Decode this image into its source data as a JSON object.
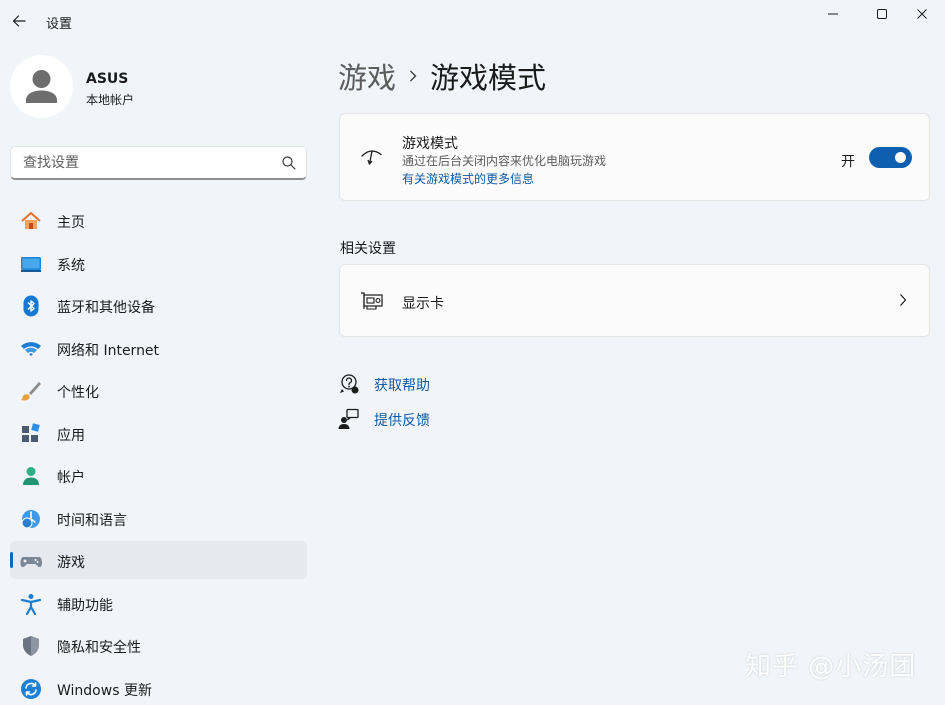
{
  "window": {
    "title": "设置",
    "back_icon": "arrow-left-icon",
    "minimize_icon": "minimize-icon",
    "maximize_icon": "maximize-icon",
    "close_icon": "close-icon"
  },
  "profile": {
    "name": "ASUS",
    "account_type": "本地帐户"
  },
  "search": {
    "placeholder": "查找设置",
    "value": ""
  },
  "sidebar": {
    "selected_index": 8,
    "items": [
      {
        "label": "主页",
        "icon": "home-icon"
      },
      {
        "label": "系统",
        "icon": "system-icon"
      },
      {
        "label": "蓝牙和其他设备",
        "icon": "bluetooth-icon"
      },
      {
        "label": "网络和 Internet",
        "icon": "wifi-icon"
      },
      {
        "label": "个性化",
        "icon": "brush-icon"
      },
      {
        "label": "应用",
        "icon": "apps-icon"
      },
      {
        "label": "帐户",
        "icon": "account-icon"
      },
      {
        "label": "时间和语言",
        "icon": "time-language-icon"
      },
      {
        "label": "游戏",
        "icon": "gamepad-icon"
      },
      {
        "label": "辅助功能",
        "icon": "accessibility-icon"
      },
      {
        "label": "隐私和安全性",
        "icon": "shield-icon"
      },
      {
        "label": "Windows 更新",
        "icon": "update-icon"
      }
    ]
  },
  "main": {
    "breadcrumb": {
      "parent": "游戏",
      "current": "游戏模式"
    },
    "game_mode": {
      "title": "游戏模式",
      "description": "通过在后台关闭内容来优化电脑玩游戏",
      "link": "有关游戏模式的更多信息",
      "toggle_label": "开",
      "toggle_on": true,
      "icon": "game-mode-icon"
    },
    "related": {
      "title": "相关设置",
      "items": [
        {
          "label": "显示卡",
          "icon": "graphics-card-icon"
        }
      ]
    },
    "help": {
      "get_help": "获取帮助",
      "feedback": "提供反馈"
    }
  },
  "colors": {
    "accent": "#0f5fb0",
    "link": "#0f5aa6",
    "background": "#f1f4f9",
    "card": "#fbfbfb"
  },
  "watermark": "知乎 @小汤团"
}
